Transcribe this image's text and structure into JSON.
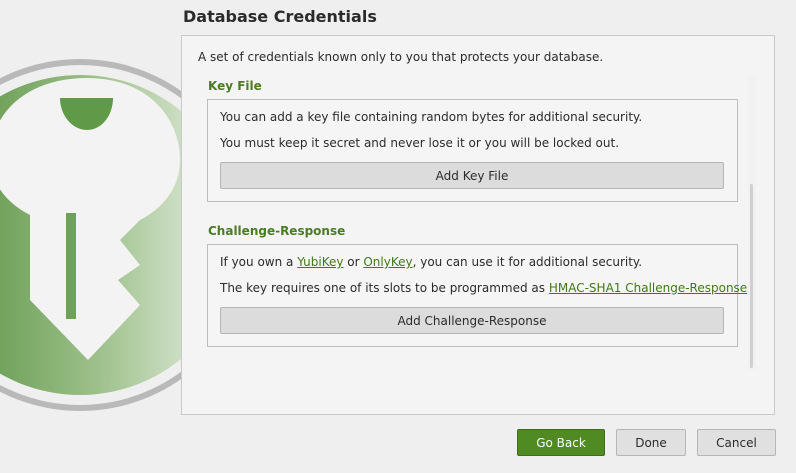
{
  "dialog": {
    "title": "Database Credentials",
    "intro": "A set of credentials known only to you that protects your database."
  },
  "key_file": {
    "title": "Key File",
    "line1": "You can add a key file containing random bytes for additional security.",
    "line2": "You must keep it secret and never lose it or you will be locked out.",
    "button": "Add Key File"
  },
  "challenge": {
    "title": "Challenge-Response",
    "line1_a": "If you own a ",
    "link_yubikey": "YubiKey",
    "line1_b": " or ",
    "link_onlykey": "OnlyKey",
    "line1_c": ", you can use it for additional security.",
    "line2_a": "The key requires one of its slots to be programmed as ",
    "link_hmac": "HMAC-SHA1 Challenge-Response",
    "line2_b": ".",
    "button": "Add Challenge-Response"
  },
  "footer": {
    "go_back": "Go Back",
    "done": "Done",
    "cancel": "Cancel"
  },
  "colors": {
    "accent_green": "#4f8a22",
    "section_title": "#4a7c21"
  },
  "icons": {
    "background_logo": "keepassxc-key-logo-icon"
  }
}
